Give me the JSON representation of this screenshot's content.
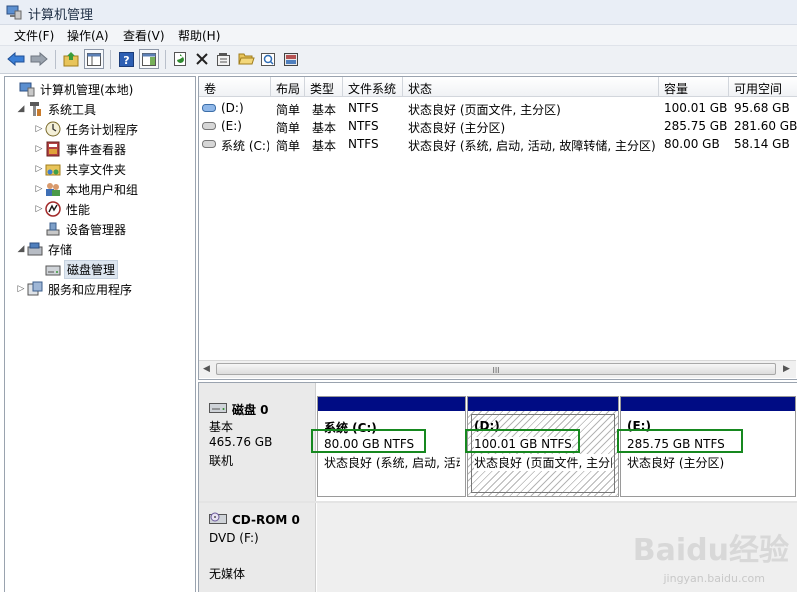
{
  "window": {
    "title": "计算机管理"
  },
  "menu": [
    "文件(F)",
    "操作(A)",
    "查看(V)",
    "帮助(H)"
  ],
  "toolbar_icons": [
    "back-arrow-icon",
    "forward-arrow-icon",
    "up-folder-icon",
    "show-hide-tree-icon",
    "help-icon",
    "action-pane-icon",
    "refresh-icon",
    "delete-icon",
    "properties-icon",
    "open-folder-icon",
    "search-icon",
    "export-icon"
  ],
  "tree": {
    "root": "计算机管理(本地)",
    "system_tools": "系统工具",
    "task_scheduler": "任务计划程序",
    "event_viewer": "事件查看器",
    "shared_folders": "共享文件夹",
    "local_users": "本地用户和组",
    "performance": "性能",
    "device_manager": "设备管理器",
    "storage": "存储",
    "disk_management": "磁盘管理",
    "services_apps": "服务和应用程序"
  },
  "volume_table": {
    "headers": [
      "卷",
      "布局",
      "类型",
      "文件系统",
      "状态",
      "容量",
      "可用空间"
    ],
    "rows": [
      [
        "(D:)",
        "简单",
        "基本",
        "NTFS",
        "状态良好 (页面文件, 主分区)",
        "100.01 GB",
        "95.68 GB"
      ],
      [
        "(E:)",
        "简单",
        "基本",
        "NTFS",
        "状态良好 (主分区)",
        "285.75 GB",
        "281.60 GB"
      ],
      [
        "系统 (C:)",
        "简单",
        "基本",
        "NTFS",
        "状态良好 (系统, 启动, 活动, 故障转储, 主分区)",
        "80.00 GB",
        "58.14 GB"
      ]
    ],
    "scroll_grip": "III"
  },
  "disks": {
    "disk0": {
      "name": "磁盘 0",
      "type": "基本",
      "size": "465.76 GB",
      "status": "联机",
      "partitions": [
        {
          "name": "系统 (C:)",
          "size_fs": "80.00 GB NTFS",
          "status": "状态良好 (系统, 启动, 活动"
        },
        {
          "name": "(D:)",
          "size_fs": "100.01 GB NTFS",
          "status": "状态良好 (页面文件, 主分区"
        },
        {
          "name": "(E:)",
          "size_fs": "285.75 GB NTFS",
          "status": "状态良好 (主分区)"
        }
      ]
    },
    "cdrom0": {
      "name": "CD-ROM 0",
      "type": "DVD (F:)",
      "status": "无媒体"
    }
  },
  "watermark": {
    "main": "Baidu经验",
    "sub": "jingyan.baidu.com"
  },
  "colors": {
    "partition_bar": "#000c84",
    "highlight": "#16881f"
  }
}
